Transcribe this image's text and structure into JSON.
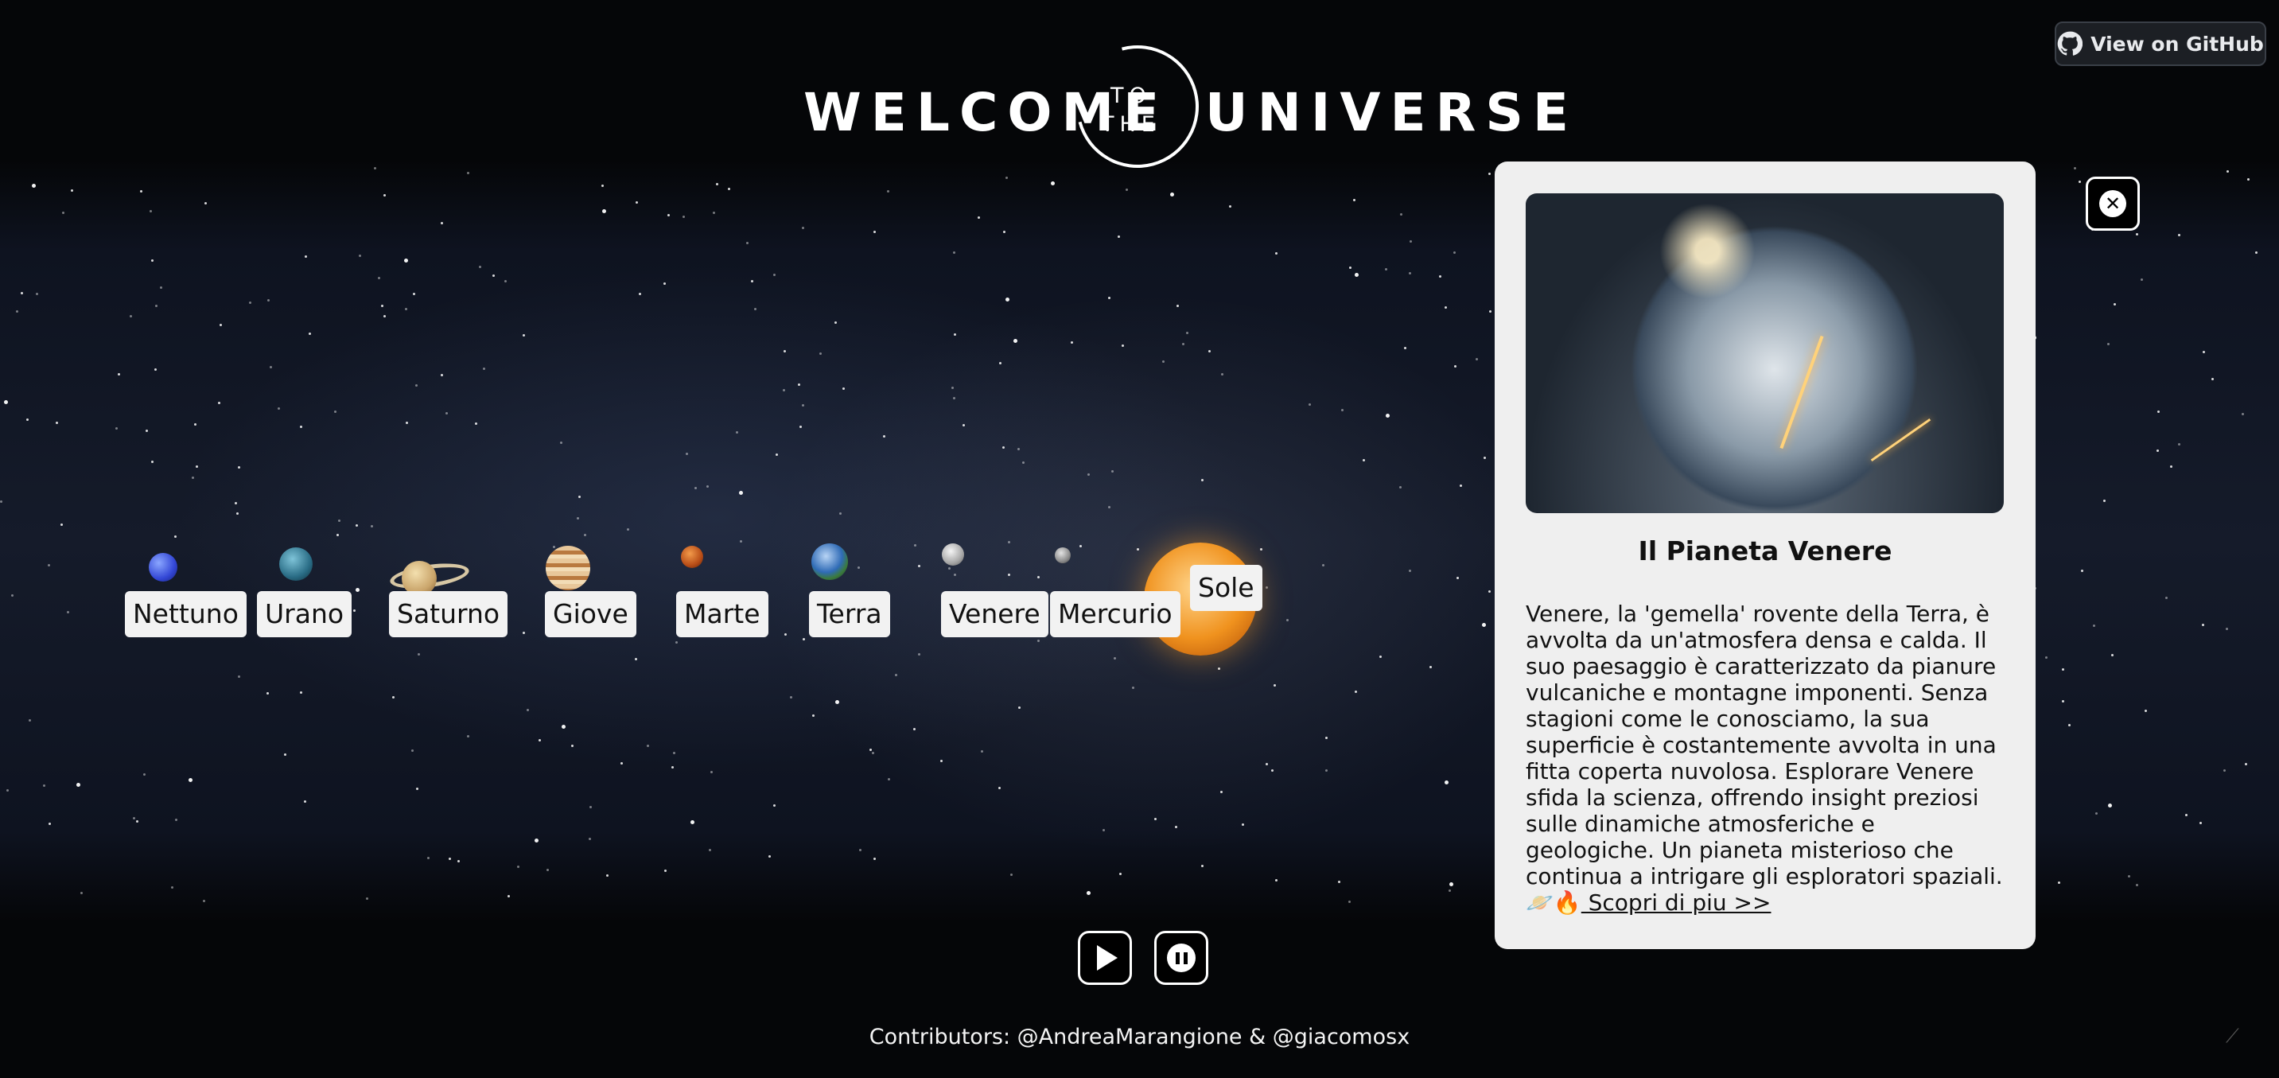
{
  "header": {
    "title_left": "WELCOME",
    "title_to": "TO",
    "title_the": "THE",
    "title_right": "UNIVERSE",
    "github_label": "View on GitHub"
  },
  "planets": [
    {
      "label": "Nettuno"
    },
    {
      "label": "Urano"
    },
    {
      "label": "Saturno"
    },
    {
      "label": "Giove"
    },
    {
      "label": "Marte"
    },
    {
      "label": "Terra"
    },
    {
      "label": "Venere"
    },
    {
      "label": "Mercurio"
    },
    {
      "label": "Sole"
    }
  ],
  "info_panel": {
    "title": "Il Pianeta Venere",
    "description": "Venere, la 'gemella' rovente della Terra, è avvolta da un'atmosfera densa e calda. Il suo paesaggio è caratterizzato da pianure vulcaniche e montagne imponenti. Senza stagioni come le conosciamo, la sua superficie è costantemente avvolta in una fitta coperta nuvolosa. Esplorare Venere sfida la scienza, offrendo insight preziosi sulle dinamiche atmosferiche e geologiche. Un pianeta misterioso che continua a intrigare gli esploratori spaziali.",
    "emoji": "🪐🔥",
    "link_text": " Scopri di piu >>"
  },
  "controls": {
    "play_icon": "play-icon",
    "pause_icon": "pause-icon",
    "close_icon": "close-icon"
  },
  "footer": {
    "contributors": "Contributors: @AndreaMarangione & @giacomosx"
  }
}
